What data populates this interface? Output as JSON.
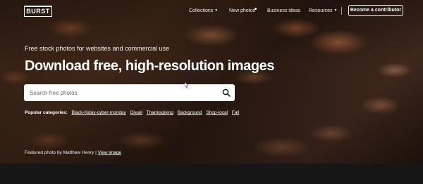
{
  "nav": {
    "logo": "BURST",
    "links": [
      {
        "label": "Collections",
        "dropdown": true
      },
      {
        "label": "New photos",
        "dot": true
      },
      {
        "label": "Business ideas"
      },
      {
        "label": "Resources",
        "dropdown": true
      }
    ],
    "contribute_label": "Become a contributor"
  },
  "hero": {
    "subtitle": "Free stock photos for websites and commercial use",
    "headline": "Download free, high-resolution images",
    "search": {
      "placeholder": "Search free photos",
      "value": ""
    },
    "categories": {
      "label": "Popular categories:",
      "items": [
        "Black-friday-cyber-monday",
        "Diwali",
        "Thanksgiving",
        "Background",
        "Shop-local",
        "Fall"
      ]
    },
    "featured": {
      "text": "Featured photo by Matthew Henry |",
      "link": "View image"
    }
  },
  "colors": {
    "button_border": "#ffffff",
    "search_bg": "#ffffff",
    "page_bg": "#161616"
  }
}
